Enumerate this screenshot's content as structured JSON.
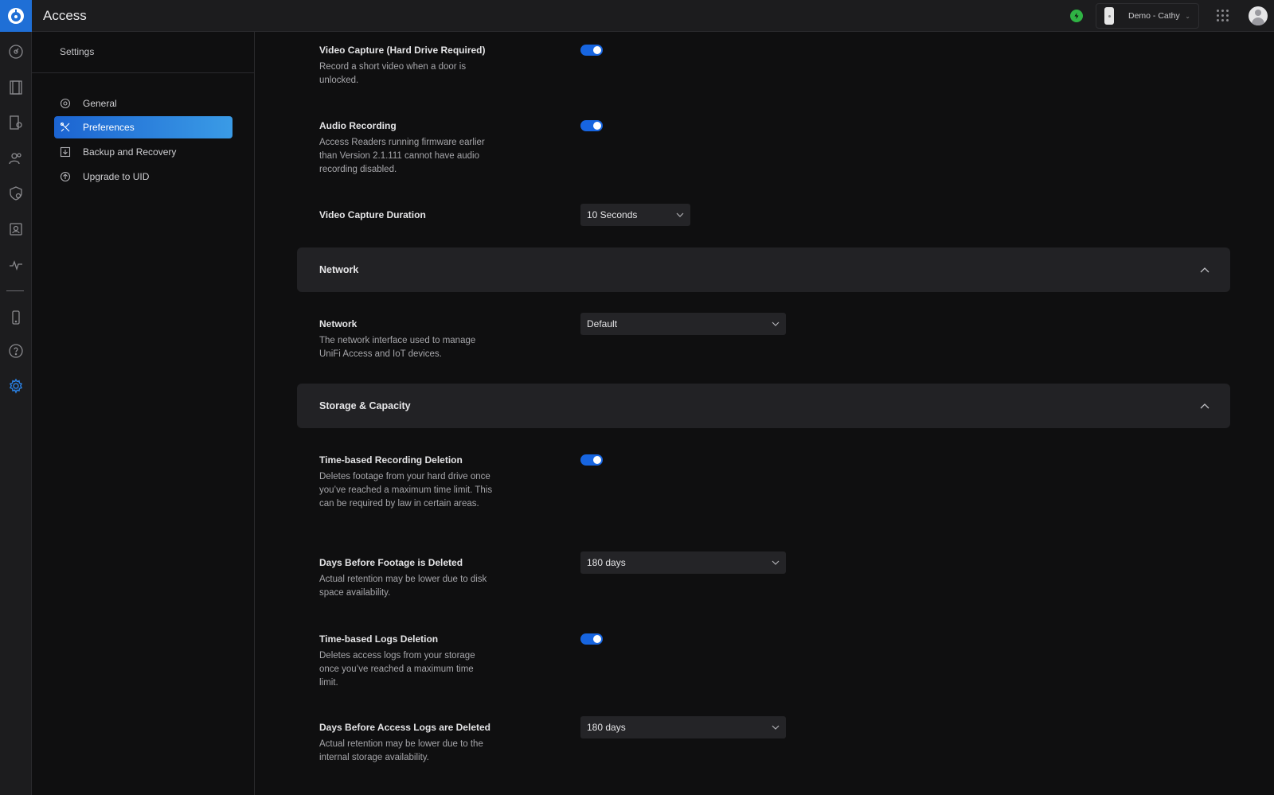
{
  "app": {
    "title": "Access"
  },
  "header": {
    "device_label": "Demo - Cathy"
  },
  "settings": {
    "heading": "Settings",
    "nav": [
      {
        "label": "General",
        "icon": "gear-outline-icon"
      },
      {
        "label": "Preferences",
        "icon": "tools-icon",
        "active": true
      },
      {
        "label": "Backup and Recovery",
        "icon": "download-box-icon"
      },
      {
        "label": "Upgrade to UID",
        "icon": "arrow-up-circle-icon"
      }
    ]
  },
  "content": {
    "video_capture": {
      "title": "Video Capture (Hard Drive Required)",
      "desc": "Record a short video when a door is unlocked.",
      "enabled": true
    },
    "audio_recording": {
      "title": "Audio Recording",
      "desc": "Access Readers running firmware earlier than Version 2.1.111 cannot have audio recording disabled.",
      "enabled": true
    },
    "video_duration": {
      "title": "Video Capture Duration",
      "value": "10 Seconds"
    },
    "network_section": {
      "title": "Network"
    },
    "network": {
      "title": "Network",
      "desc": "The network interface used to manage UniFi Access and IoT devices.",
      "value": "Default"
    },
    "storage_section": {
      "title": "Storage & Capacity"
    },
    "recording_deletion": {
      "title": "Time-based Recording Deletion",
      "desc": "Deletes footage from your hard drive once you’ve reached a maximum time limit. This can be required by law in certain areas.",
      "enabled": true
    },
    "footage_days": {
      "title": "Days Before Footage is Deleted",
      "desc": "Actual retention may be lower due to disk space availability.",
      "value": "180 days"
    },
    "logs_deletion": {
      "title": "Time-based Logs Deletion",
      "desc": "Deletes access logs from your storage once you’ve reached a maximum time limit.",
      "enabled": true
    },
    "logs_days": {
      "title": "Days Before Access Logs are Deleted",
      "desc": "Actual retention may be lower due to the internal storage availability.",
      "value": "180 days"
    }
  },
  "colors": {
    "accent": "#1765e0",
    "status": "#2fb344",
    "active_nav": "#2a7fe0"
  }
}
